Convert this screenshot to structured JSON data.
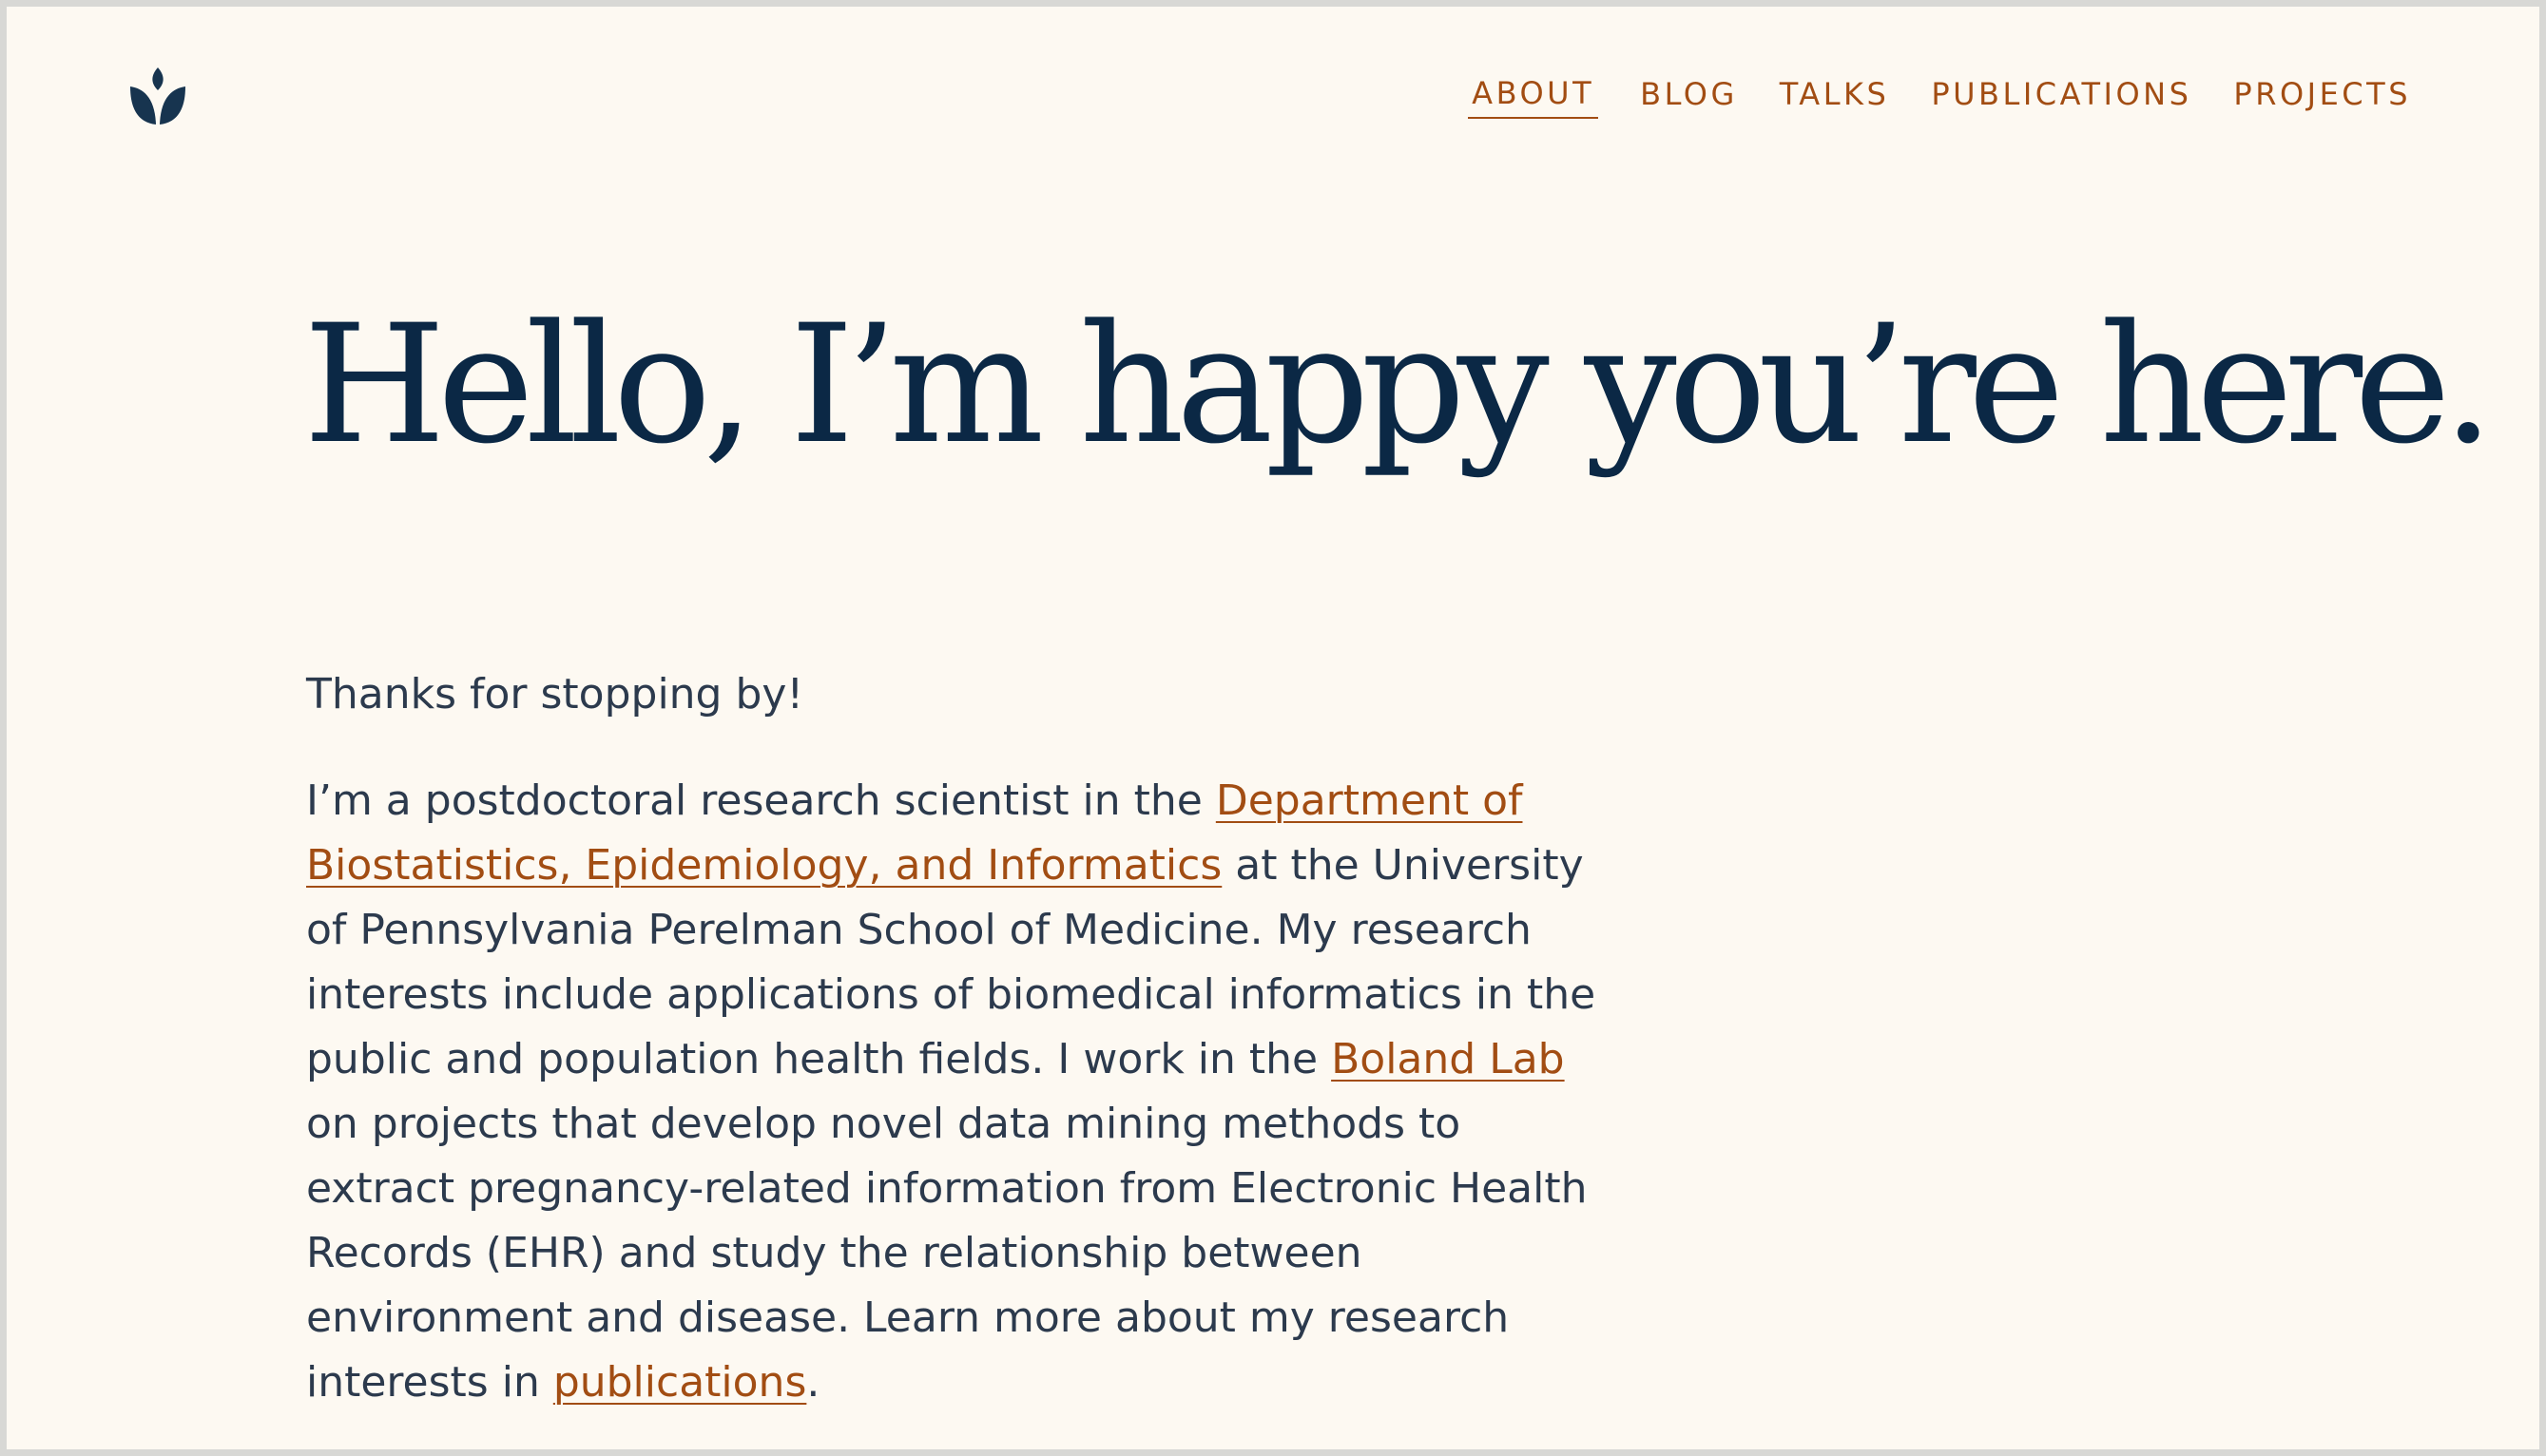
{
  "header": {
    "nav": [
      {
        "label": "ABOUT",
        "active": true
      },
      {
        "label": "BLOG",
        "active": false
      },
      {
        "label": "TALKS",
        "active": false
      },
      {
        "label": "PUBLICATIONS",
        "active": false
      },
      {
        "label": "PROJECTS",
        "active": false
      }
    ]
  },
  "colors": {
    "background": "#fdf9f2",
    "heading": "#0b2845",
    "body_text": "#2c3a4d",
    "accent": "#a24d13",
    "logo": "#17344f"
  },
  "icons": {
    "logo": "lotus-icon"
  },
  "hero": {
    "title": "Hello, I’m happy you’re here."
  },
  "intro": {
    "greeting": "Thanks for stopping by!",
    "p_start": "I’m a postdoctoral research scientist in the ",
    "link_department": "Department of Biostatistics, Epidemiology, and Informatics",
    "p_middle": " at the University of Pennsylvania Perelman School of Medicine. My research interests include applications of biomedical informatics in the public and population health fields. I work in the ",
    "link_lab": "Boland Lab",
    "p_after_lab": " on projects that develop novel data mining methods to extract pregnancy-related information from Electronic Health Records (EHR) and study the relationship between environment and disease. Learn more about my research interests in ",
    "link_publications": "publications",
    "p_end": "."
  }
}
